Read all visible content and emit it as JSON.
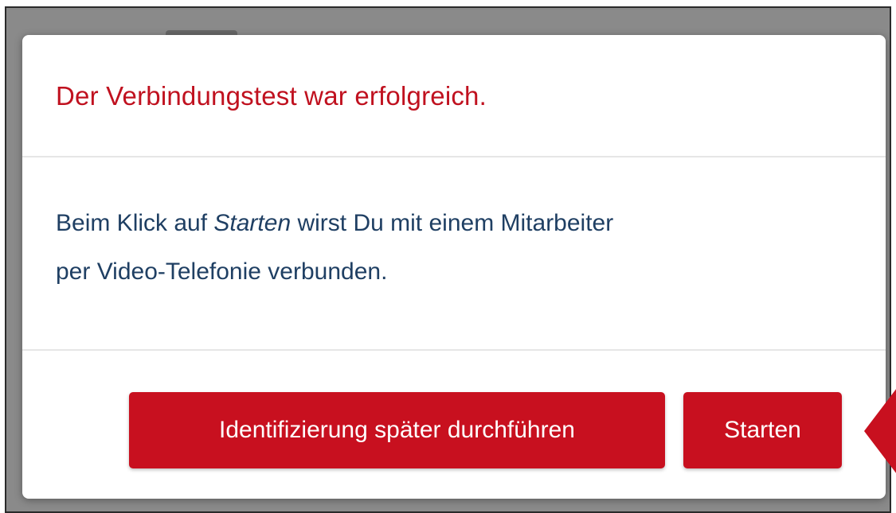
{
  "dialog": {
    "title": "Der Verbindungstest war erfolgreich.",
    "message_before": "Beim Klick auf ",
    "message_emphasis": "Starten",
    "message_line1_after": " wirst Du mit einem Mitarbeiter",
    "message_line2": "per Video-Telefonie verbunden.",
    "buttons": {
      "later_label": "Identifizierung später durchführen",
      "start_label": "Starten"
    }
  },
  "colors": {
    "accent_red": "#c8101f",
    "title_red": "#c0111f",
    "body_text": "#1f3f63",
    "overlay_gray": "#8a8a8a"
  },
  "icons": {
    "pointer": "arrow-pointer-left-icon"
  }
}
